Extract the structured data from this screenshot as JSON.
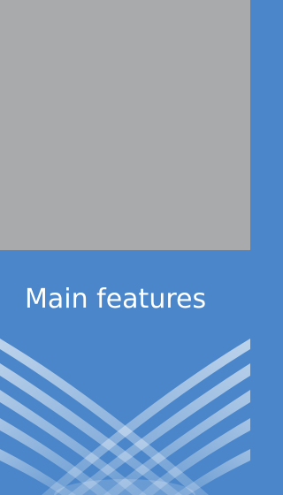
{
  "page": {
    "top_panel_color": "#a9aaac",
    "bottom_panel_color": "#4a86c9",
    "beam_color": "#ffffff"
  },
  "banner": {
    "title": "Main features"
  },
  "decoration": {
    "icon": "light-beams-graphic"
  }
}
